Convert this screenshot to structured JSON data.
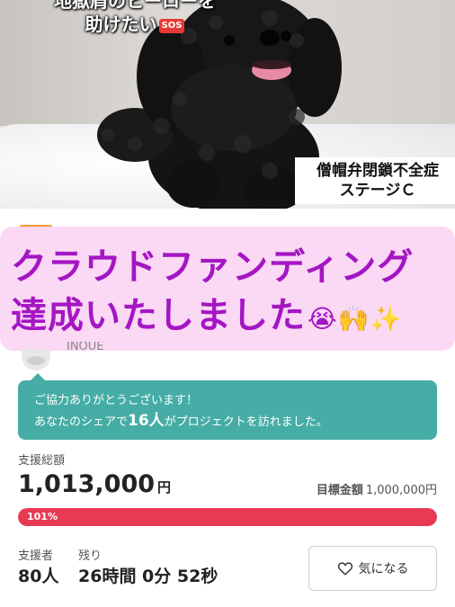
{
  "hero": {
    "title_line1": "地獄肩のヒーローを",
    "title_line2": "助けたい",
    "sos_badge": "SOS",
    "caption_line1": "僧帽弁閉鎖不全症",
    "caption_line2": "ステージＣ"
  },
  "banner": {
    "line1": "クラウドファンディング",
    "line2": "達成いたしました",
    "emojis": "😭🙌✨",
    "color": "#a416c4",
    "background": "#fbd8f4"
  },
  "owner": {
    "name": "INOUE"
  },
  "share": {
    "thanks": "ご協力ありがとうございます！",
    "prefix": "あなたのシェアで",
    "count": "16人",
    "suffix": "がプロジェクトを訪れました。",
    "background": "#45ada5"
  },
  "funding": {
    "total_label": "支援総額",
    "total_amount": "1,013,000",
    "currency_unit": "円",
    "goal_label": "目標金額",
    "goal_amount": "1,000,000円",
    "progress_text": "101%",
    "progress_fraction": 1.0,
    "progress_color": "#e83a53"
  },
  "stats": {
    "supporters_label": "支援者",
    "supporters_value": "80人",
    "remaining_label": "残り",
    "remaining_value": "26時間 0分 52秒"
  },
  "favorite_button": {
    "label": "気になる",
    "icon": "heart-outline-icon"
  }
}
